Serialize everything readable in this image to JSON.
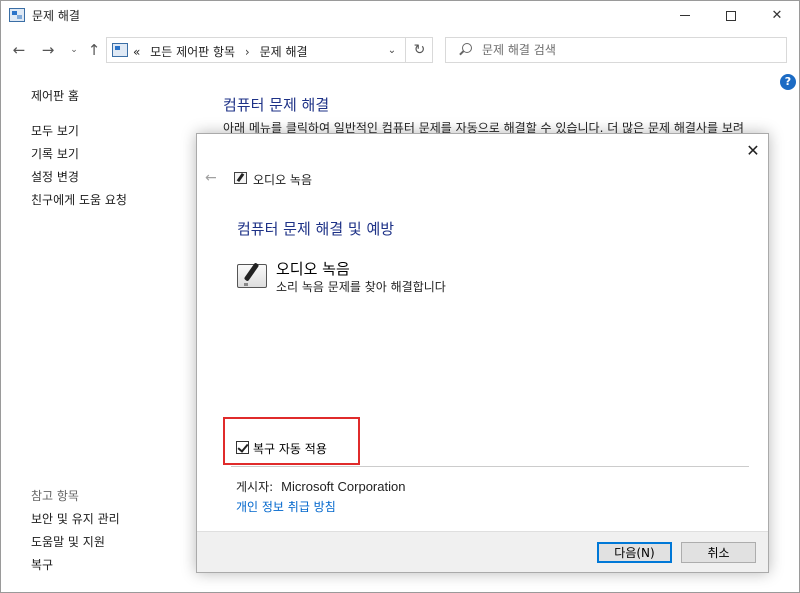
{
  "window": {
    "title": "문제 해결",
    "minimize_icon": "minimize-icon",
    "maximize_icon": "maximize-icon",
    "close_glyph": "✕"
  },
  "nav": {
    "back_glyph": "←",
    "forward_glyph": "→",
    "dropdown_glyph": "⌄",
    "up_glyph": "↑",
    "address": {
      "prefix": "«",
      "crumb1": "모든 제어판 항목",
      "separator": "›",
      "crumb2": "문제 해결",
      "dropdown_glyph": "⌄",
      "refresh_glyph": "↻"
    },
    "search": {
      "placeholder": "문제 해결 검색",
      "value": ""
    }
  },
  "help": {
    "label": "?"
  },
  "sidebar": {
    "home": "제어판 홈",
    "items": [
      "모두 보기",
      "기록 보기",
      "설정 변경",
      "친구에게 도움 요청"
    ],
    "see_also_header": "참고 항목",
    "see_also": [
      "보안 및 유지 관리",
      "도움말 및 지원",
      "복구"
    ]
  },
  "main": {
    "title": "컴퓨터 문제 해결",
    "description": "아래 메뉴를 클릭하여 일반적인 컴퓨터 문제를 자동으로 해결할 수 있습니다. 더 많은 문제 해결사를 보려"
  },
  "dialog": {
    "close_glyph": "✕",
    "back_glyph": "←",
    "header_text": "오디오 녹음",
    "title": "컴퓨터 문제 해결 및 예방",
    "item_name": "오디오 녹음",
    "item_description": "소리 녹음 문제를 찾아 해결합니다",
    "auto_repair_label": "복구 자동 적용",
    "auto_repair_checked": true,
    "publisher_label": "게시자:",
    "publisher_value": "Microsoft Corporation",
    "privacy_link": "개인 정보 취급 방침",
    "next_button": "다음(N)",
    "cancel_button": "취소"
  },
  "colors": {
    "heading_blue": "#1e3287",
    "link_blue": "#0066cc",
    "highlight_red": "#e02b2b",
    "help_blue": "#1c6bc4"
  }
}
